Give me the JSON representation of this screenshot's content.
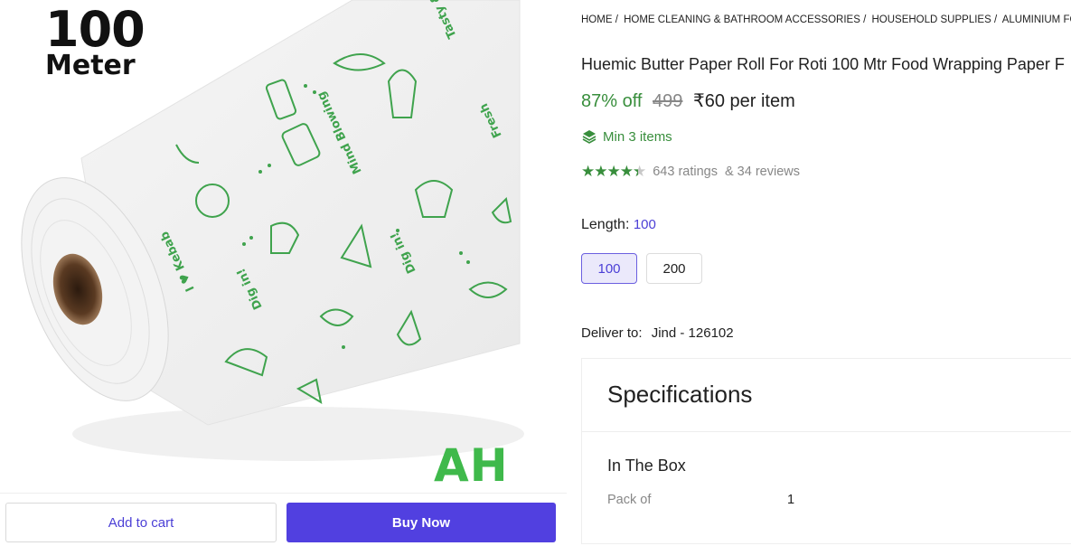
{
  "image": {
    "badge_number": "100",
    "badge_unit": "Meter",
    "corner_mark": "AH",
    "accent_color": "#3fb94b"
  },
  "actions": {
    "add_to_cart": "Add to cart",
    "buy_now": "Buy Now"
  },
  "breadcrumb": [
    "HOME /",
    "HOME CLEANING & BATHROOM ACCESSORIES /",
    "HOUSEHOLD SUPPLIES /",
    "ALUMINIUM FOILS &"
  ],
  "product": {
    "title": "Huemic Butter Paper Roll For Roti 100 Mtr Food Wrapping Paper F",
    "discount": "87% off",
    "mrp": "499",
    "price": "₹60 per item",
    "min_items": "Min 3 items",
    "rating_value": 4.3,
    "ratings_text": "643 ratings",
    "reviews_text": "& 34 reviews"
  },
  "length": {
    "label": "Length:",
    "selected": "100",
    "options": [
      "100",
      "200"
    ]
  },
  "delivery": {
    "label": "Deliver to:",
    "location": "Jind - 126102"
  },
  "specifications": {
    "heading": "Specifications",
    "section": "In The Box",
    "rows": [
      {
        "key": "Pack of",
        "value": "1"
      }
    ]
  },
  "colors": {
    "primary": "#5140e0",
    "green": "#388e3c",
    "muted": "#878787"
  }
}
